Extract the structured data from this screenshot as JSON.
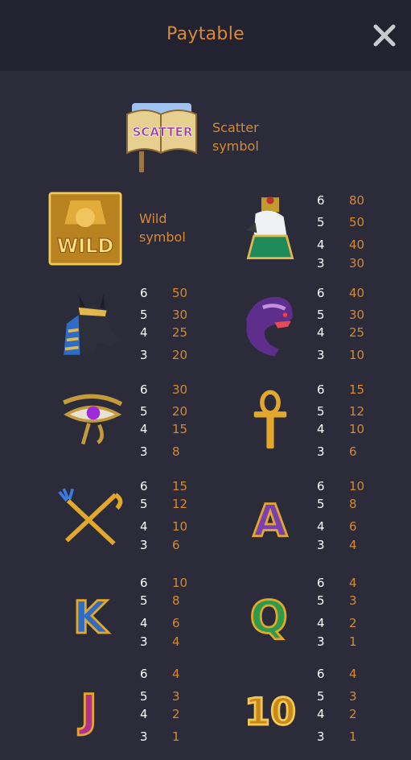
{
  "header": {
    "title": "Paytable"
  },
  "scatter": {
    "label_line1": "Scatter",
    "label_line2": "symbol",
    "badge_text": "SCATTER"
  },
  "wild": {
    "label_line1": "Wild",
    "label_line2": "symbol",
    "badge_text": "WILD"
  },
  "symbols": [
    {
      "name": "horus",
      "pays": [
        {
          "count": "6",
          "value": "80"
        },
        {
          "count": "5",
          "value": "50"
        },
        {
          "count": "4",
          "value": "40"
        },
        {
          "count": "3",
          "value": "30"
        }
      ]
    },
    {
      "name": "anubis",
      "pays": [
        {
          "count": "6",
          "value": "50"
        },
        {
          "count": "5",
          "value": "30"
        },
        {
          "count": "4",
          "value": "25"
        },
        {
          "count": "3",
          "value": "20"
        }
      ]
    },
    {
      "name": "cobra",
      "pays": [
        {
          "count": "6",
          "value": "40"
        },
        {
          "count": "5",
          "value": "30"
        },
        {
          "count": "4",
          "value": "25"
        },
        {
          "count": "3",
          "value": "10"
        }
      ]
    },
    {
      "name": "eye-of-horus",
      "pays": [
        {
          "count": "6",
          "value": "30"
        },
        {
          "count": "5",
          "value": "20"
        },
        {
          "count": "4",
          "value": "15"
        },
        {
          "count": "3",
          "value": "8"
        }
      ]
    },
    {
      "name": "ankh",
      "pays": [
        {
          "count": "6",
          "value": "15"
        },
        {
          "count": "5",
          "value": "12"
        },
        {
          "count": "4",
          "value": "10"
        },
        {
          "count": "3",
          "value": "6"
        }
      ]
    },
    {
      "name": "crook-and-flail",
      "pays": [
        {
          "count": "6",
          "value": "15"
        },
        {
          "count": "5",
          "value": "12"
        },
        {
          "count": "4",
          "value": "10"
        },
        {
          "count": "3",
          "value": "6"
        }
      ]
    },
    {
      "name": "letter-a",
      "letter": "A",
      "pays": [
        {
          "count": "6",
          "value": "10"
        },
        {
          "count": "5",
          "value": "8"
        },
        {
          "count": "4",
          "value": "6"
        },
        {
          "count": "3",
          "value": "4"
        }
      ]
    },
    {
      "name": "letter-k",
      "letter": "K",
      "pays": [
        {
          "count": "6",
          "value": "10"
        },
        {
          "count": "5",
          "value": "8"
        },
        {
          "count": "4",
          "value": "6"
        },
        {
          "count": "3",
          "value": "4"
        }
      ]
    },
    {
      "name": "letter-q",
      "letter": "Q",
      "pays": [
        {
          "count": "6",
          "value": "4"
        },
        {
          "count": "5",
          "value": "3"
        },
        {
          "count": "4",
          "value": "2"
        },
        {
          "count": "3",
          "value": "1"
        }
      ]
    },
    {
      "name": "letter-j",
      "letter": "J",
      "pays": [
        {
          "count": "6",
          "value": "4"
        },
        {
          "count": "5",
          "value": "3"
        },
        {
          "count": "4",
          "value": "2"
        },
        {
          "count": "3",
          "value": "1"
        }
      ]
    },
    {
      "name": "number-10",
      "letter": "10",
      "pays": [
        {
          "count": "6",
          "value": "4"
        },
        {
          "count": "5",
          "value": "3"
        },
        {
          "count": "4",
          "value": "2"
        },
        {
          "count": "3",
          "value": "1"
        }
      ]
    }
  ],
  "colors": {
    "background": "#2c2b39",
    "header": "#232230",
    "accent": "#d68a36",
    "count_text": "#ffffff"
  }
}
